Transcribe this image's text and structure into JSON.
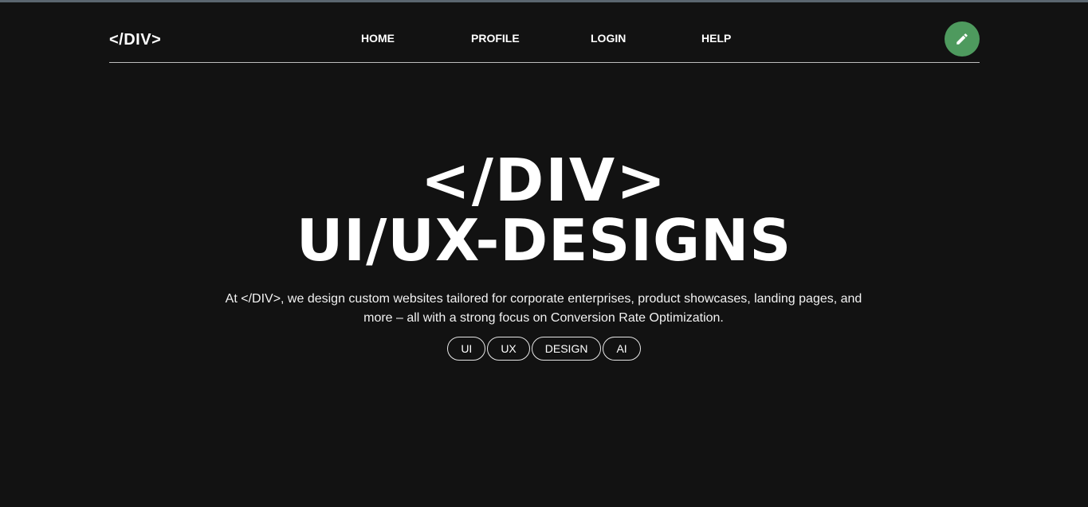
{
  "header": {
    "logo": "</DIV>",
    "nav": [
      {
        "label": "HOME"
      },
      {
        "label": "PROFILE"
      },
      {
        "label": "LOGIN"
      },
      {
        "label": "HELP"
      }
    ],
    "fab_icon": "pencil-icon",
    "fab_color": "#4e9a5e"
  },
  "hero": {
    "title_line1": "</DIV>",
    "title_line2": "UI/UX-DESIGNS",
    "description": "At </DIV>, we design custom websites tailored for corporate enterprises, product showcases, landing pages, and more – all with a strong focus on Conversion Rate Optimization.",
    "tags": [
      "UI",
      "UX",
      "DESIGN",
      "AI"
    ]
  },
  "colors": {
    "background": "#121212",
    "text": "#ffffff",
    "accent": "#4e9a5e"
  }
}
